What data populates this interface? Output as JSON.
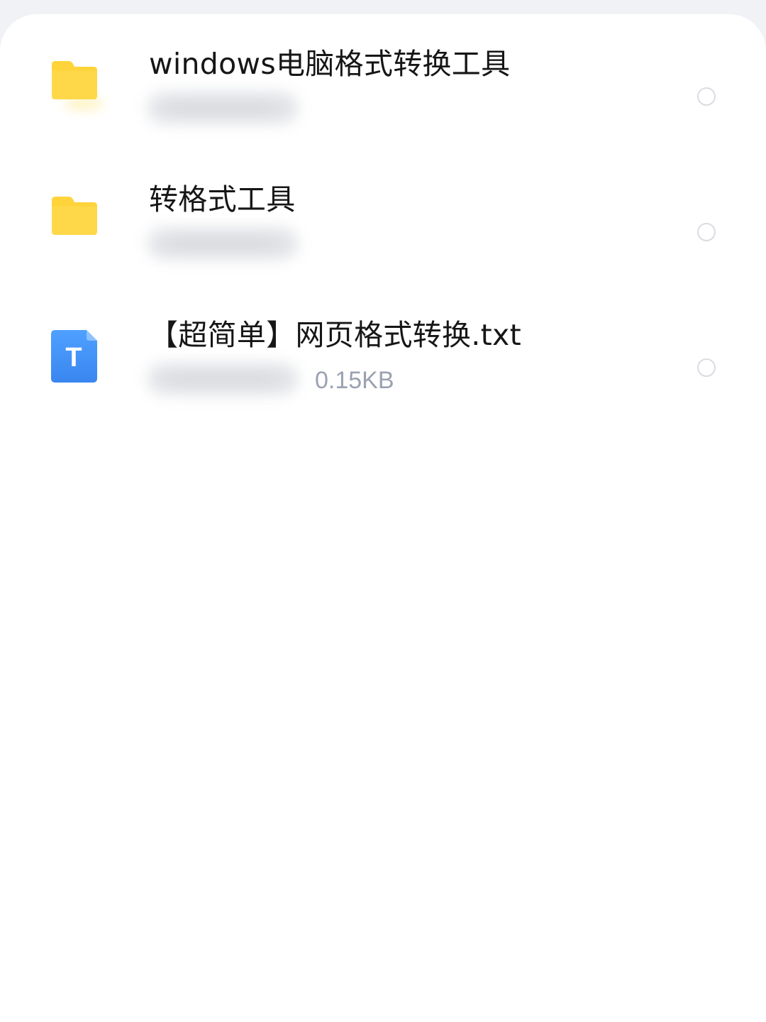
{
  "files": [
    {
      "name": "windows电脑格式转换工具",
      "type": "folder",
      "icon": "folder-icon",
      "meta_size": "",
      "selected": false
    },
    {
      "name": "转格式工具",
      "type": "folder",
      "icon": "folder-icon",
      "meta_size": "",
      "selected": false
    },
    {
      "name": "【超简单】网页格式转换.txt",
      "type": "txt",
      "icon": "txt-file-icon",
      "icon_letter": "T",
      "meta_size": "0.15KB",
      "selected": false
    }
  ],
  "colors": {
    "folder": "#FFD43B",
    "txt_icon": "#3E8EF7",
    "meta_text": "#9AA2B1",
    "background": "#F1F2F6"
  }
}
